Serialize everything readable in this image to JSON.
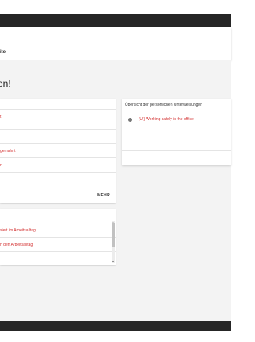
{
  "app_bar": {
    "title": "ite"
  },
  "greeting": "en!",
  "left_card_1": {
    "rows": [
      {
        "label": "t"
      },
      {
        "label": ""
      },
      {
        "label": "gemahnt"
      },
      {
        "label": "rt"
      },
      {
        "label": ""
      }
    ],
    "more_label": "MEHR"
  },
  "left_card_2": {
    "items": [
      {
        "label": "siert im Arbeitsalltag"
      },
      {
        "label": "n den Arbeitsalltag"
      }
    ]
  },
  "right_card": {
    "title": "Übersicht der persönlichen Unterweisungen",
    "items": [
      {
        "label": "[UI] Working safely in the office",
        "icon": "circle-bullet-icon"
      }
    ]
  },
  "colors": {
    "accent_link": "#d32f2f",
    "frame": "#262626",
    "background": "#f3f3f3"
  }
}
